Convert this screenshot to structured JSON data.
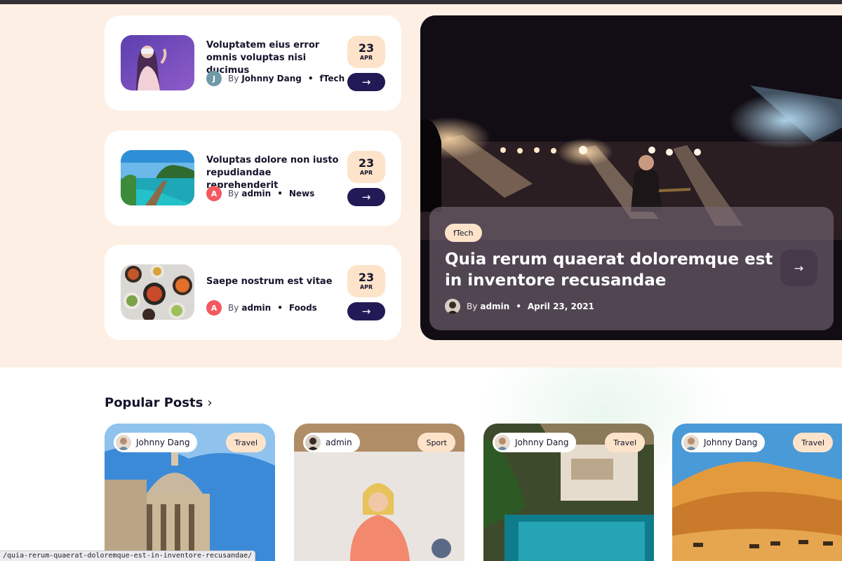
{
  "small_posts": [
    {
      "title": "Voluptatem eius error omnis voluptas nisi ducimus",
      "avatar_letter": "J",
      "avatar_color": "#6f9aa8",
      "by": "By",
      "author": "Johnny Dang",
      "category": "fTech",
      "day": "23",
      "month": "APR",
      "image": "vr-headset-woman"
    },
    {
      "title": "Voluptas dolore non iusto repudiandae reprehenderit",
      "avatar_letter": "A",
      "avatar_color": "#f3595f",
      "by": "By",
      "author": "admin",
      "category": "News",
      "day": "23",
      "month": "APR",
      "image": "tropical-pier"
    },
    {
      "title": "Saepe nostrum est vitae",
      "avatar_letter": "A",
      "avatar_color": "#f3595f",
      "by": "By",
      "author": "admin",
      "category": "Foods",
      "day": "23",
      "month": "APR",
      "image": "food-bowls"
    }
  ],
  "feature": {
    "category": "fTech",
    "title": "Quia rerum quaerat doloremque est in inventore recusandae",
    "by": "By",
    "author": "admin",
    "date": "April 23, 2021",
    "image": "concert-stage"
  },
  "popular": {
    "title": "Popular Posts",
    "chevron": "›",
    "posts": [
      {
        "author": "Johnny Dang",
        "category": "Travel",
        "image": "capitol-dome"
      },
      {
        "author": "admin",
        "category": "Sport",
        "image": "fitness-woman"
      },
      {
        "author": "Johnny Dang",
        "category": "Travel",
        "image": "resort-pool"
      },
      {
        "author": "Johnny Dang",
        "category": "Travel",
        "image": "desert-camels"
      }
    ]
  },
  "arrow_glyph": "→",
  "status_url": "/quia-rerum-quaerat-doloremque-est-in-inventore-recusandae/",
  "colors": {
    "accent": "#221a56",
    "badge": "#fde3ca",
    "hero_bg": "#fdefe3"
  }
}
